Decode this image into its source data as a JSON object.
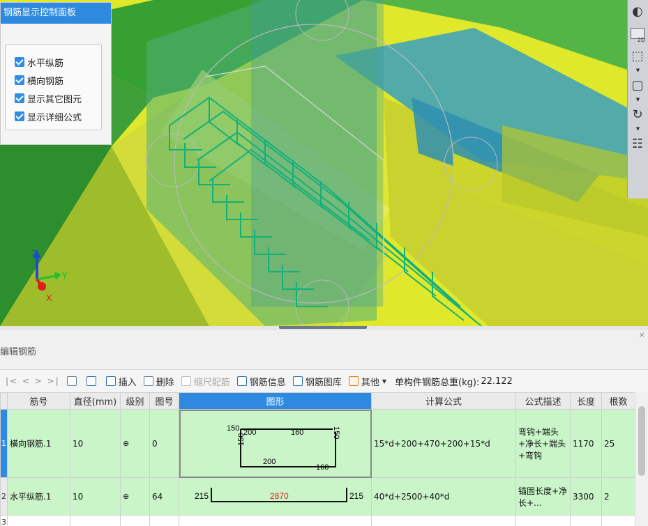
{
  "control_panel": {
    "title": "钢筋显示控制面板",
    "options": [
      {
        "label": "水平纵筋",
        "checked": true
      },
      {
        "label": "横向钢筋",
        "checked": true
      },
      {
        "label": "显示其它图元",
        "checked": true
      },
      {
        "label": "显示详细公式",
        "checked": true
      }
    ]
  },
  "right_toolbar": {
    "items": [
      {
        "icon": "orbit-icon"
      },
      {
        "icon": "2d-view-icon",
        "label": "2D"
      },
      {
        "icon": "cube-view-icon"
      },
      {
        "icon": "cube-outline-icon"
      },
      {
        "icon": "rotate-icon"
      },
      {
        "icon": "grid-list-icon"
      }
    ]
  },
  "axis": {
    "z": "Z",
    "y": "Y",
    "x": "X"
  },
  "edit_panel": {
    "title": "编辑钢筋",
    "close": "×"
  },
  "toolbar": {
    "nav": "|< < > >|",
    "insert": "插入",
    "delete": "删除",
    "scale_rebar": "缩尺配筋",
    "rebar_info": "钢筋信息",
    "rebar_library": "钢筋图库",
    "other": "其他",
    "total_weight_label": "单构件钢筋总重(kg): ",
    "total_weight": "22.122"
  },
  "table": {
    "headers": [
      "",
      "筋号",
      "直径(mm)",
      "级别",
      "图号",
      "图形",
      "计算公式",
      "公式描述",
      "长度",
      "根数"
    ],
    "rows": [
      {
        "num": "1",
        "name": "横向钢筋.1",
        "diameter": "10",
        "grade": "⊕",
        "fig_no": "0",
        "shape": {
          "a": "150",
          "b": "200",
          "c": "160",
          "d": "150",
          "e": "200",
          "f": "160"
        },
        "formula": "15*d+200+470+200+15*d",
        "description": "弯钩+端头+净长+端头+弯钩",
        "length": "1170",
        "count": "25",
        "selected": true
      },
      {
        "num": "2",
        "name": "水平纵筋.1",
        "diameter": "10",
        "grade": "⊕",
        "fig_no": "64",
        "shape": {
          "left": "215",
          "mid": "2870",
          "right": "215"
        },
        "formula": "40*d+2500+40*d",
        "description": "锚固长度+净长+…",
        "length": "3300",
        "count": "2",
        "selected": false
      },
      {
        "num": "3"
      }
    ]
  }
}
